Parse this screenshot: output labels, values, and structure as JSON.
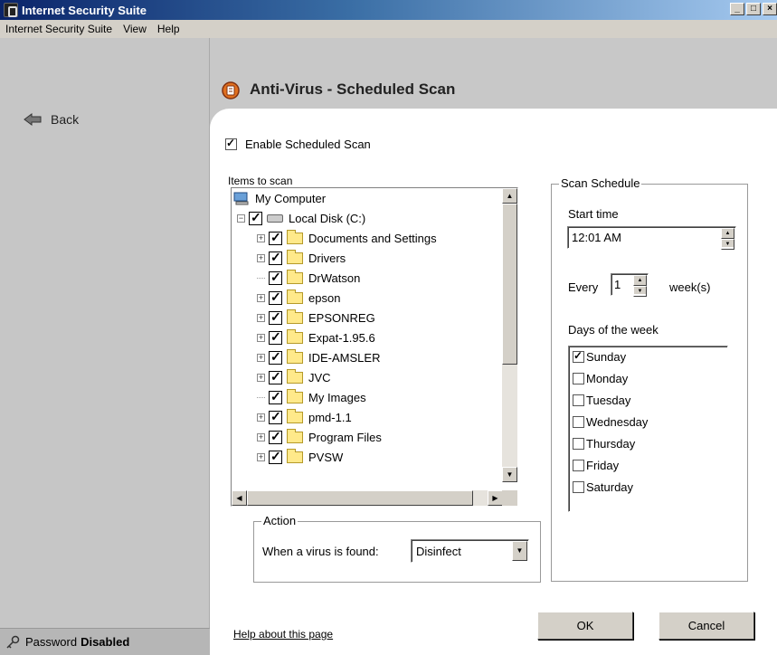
{
  "window": {
    "title": "Internet Security Suite",
    "minimize": "_",
    "maximize": "□",
    "close": "×"
  },
  "menu": [
    "Internet Security Suite",
    "View",
    "Help"
  ],
  "sidebar": {
    "back_label": "Back",
    "password_label": "Password",
    "password_status": "Disabled"
  },
  "page": {
    "title": "Anti-Virus - Scheduled Scan"
  },
  "enable_scan": {
    "label": "Enable Scheduled Scan",
    "checked": true
  },
  "items": {
    "label": "Items to scan",
    "root": "My Computer",
    "disk": "Local Disk (C:)",
    "folders": [
      {
        "name": "Documents and Settings",
        "expandable": true
      },
      {
        "name": "Drivers",
        "expandable": true
      },
      {
        "name": "DrWatson",
        "expandable": false
      },
      {
        "name": "epson",
        "expandable": true
      },
      {
        "name": "EPSONREG",
        "expandable": true
      },
      {
        "name": "Expat-1.95.6",
        "expandable": true
      },
      {
        "name": "IDE-AMSLER",
        "expandable": true
      },
      {
        "name": "JVC",
        "expandable": true
      },
      {
        "name": "My Images",
        "expandable": false
      },
      {
        "name": "pmd-1.1",
        "expandable": true
      },
      {
        "name": "Program Files",
        "expandable": true
      },
      {
        "name": "PVSW",
        "expandable": true
      }
    ]
  },
  "schedule": {
    "legend": "Scan Schedule",
    "start_time_label": "Start time",
    "start_time": "12:01 AM",
    "every_label": "Every",
    "every_value": "1",
    "every_unit": "week(s)",
    "days_label": "Days of the week",
    "days": [
      {
        "name": "Sunday",
        "checked": true
      },
      {
        "name": "Monday",
        "checked": false
      },
      {
        "name": "Tuesday",
        "checked": false
      },
      {
        "name": "Wednesday",
        "checked": false
      },
      {
        "name": "Thursday",
        "checked": false
      },
      {
        "name": "Friday",
        "checked": false
      },
      {
        "name": "Saturday",
        "checked": false
      }
    ]
  },
  "action": {
    "legend": "Action",
    "label": "When a virus is found:",
    "value": "Disinfect"
  },
  "footer": {
    "help_link": "Help about this page",
    "ok": "OK",
    "cancel": "Cancel"
  }
}
